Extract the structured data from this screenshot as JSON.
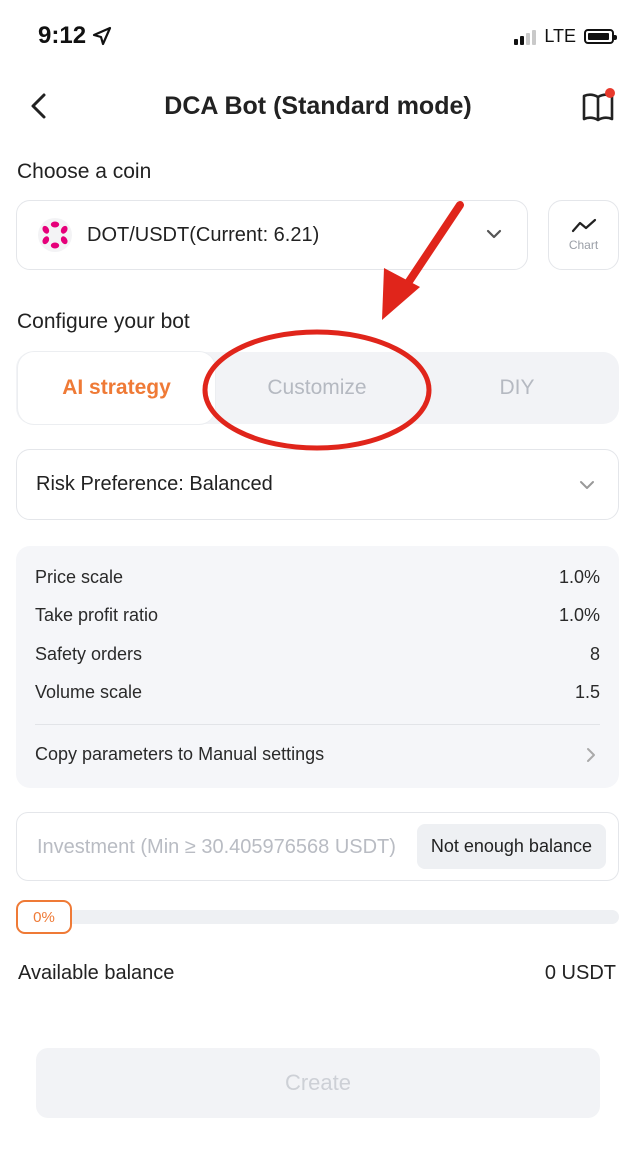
{
  "status_bar": {
    "time": "9:12",
    "network": "LTE"
  },
  "header": {
    "title": "DCA Bot (Standard mode)"
  },
  "coin_section": {
    "label": "Choose a coin",
    "selected_pair": "DOT/USDT(Current: 6.21)",
    "chart_label": "Chart"
  },
  "config_section": {
    "label": "Configure your bot",
    "tabs": [
      {
        "label": "AI strategy",
        "active": true
      },
      {
        "label": "Customize",
        "active": false
      },
      {
        "label": "DIY",
        "active": false
      }
    ],
    "risk_preference": "Risk Preference: Balanced"
  },
  "parameters": {
    "rows": [
      {
        "label": "Price scale",
        "value": "1.0%"
      },
      {
        "label": "Take profit ratio",
        "value": "1.0%"
      },
      {
        "label": "Safety orders",
        "value": "8"
      },
      {
        "label": "Volume scale",
        "value": "1.5"
      }
    ],
    "copy_label": "Copy parameters to Manual settings"
  },
  "investment": {
    "placeholder": "Investment (Min ≥ 30.405976568 USDT)",
    "balance_button": "Not enough balance"
  },
  "slider": {
    "percent": "0%",
    "value": 0
  },
  "balance": {
    "label": "Available balance",
    "value": "0 USDT"
  },
  "create_label": "Create",
  "colors": {
    "accent": "#ef7a36",
    "annotation": "#e0251b"
  },
  "icons": [
    "location-arrow-icon",
    "back-arrow-icon",
    "guide-book-icon",
    "polkadot-logo-icon",
    "chevron-down-icon",
    "chart-line-icon",
    "chevron-right-icon"
  ]
}
